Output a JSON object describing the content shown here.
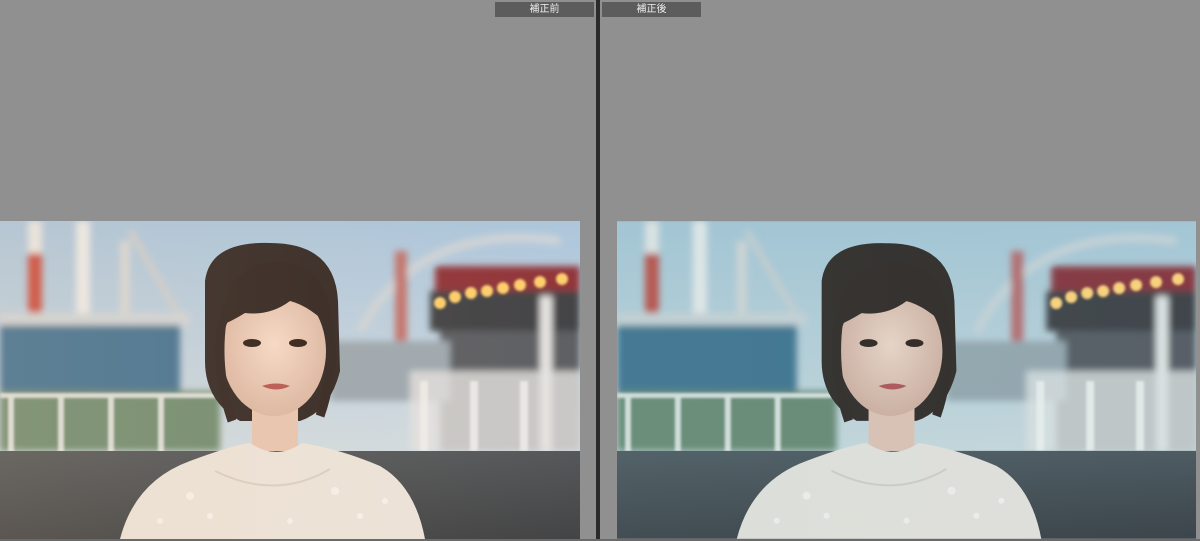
{
  "compare_view": {
    "before_label": "補正前",
    "after_label": "補正後"
  },
  "colors": {
    "background": "#8f8f8f",
    "label_bg": "#5c5c5c",
    "label_text": "#f0f0f0",
    "divider": "#2b2b2b",
    "before_tint": "#f2c89a",
    "after_tint": "#9fc6c6"
  },
  "photo": {
    "subject": "portrait-woman-amusement-park"
  }
}
